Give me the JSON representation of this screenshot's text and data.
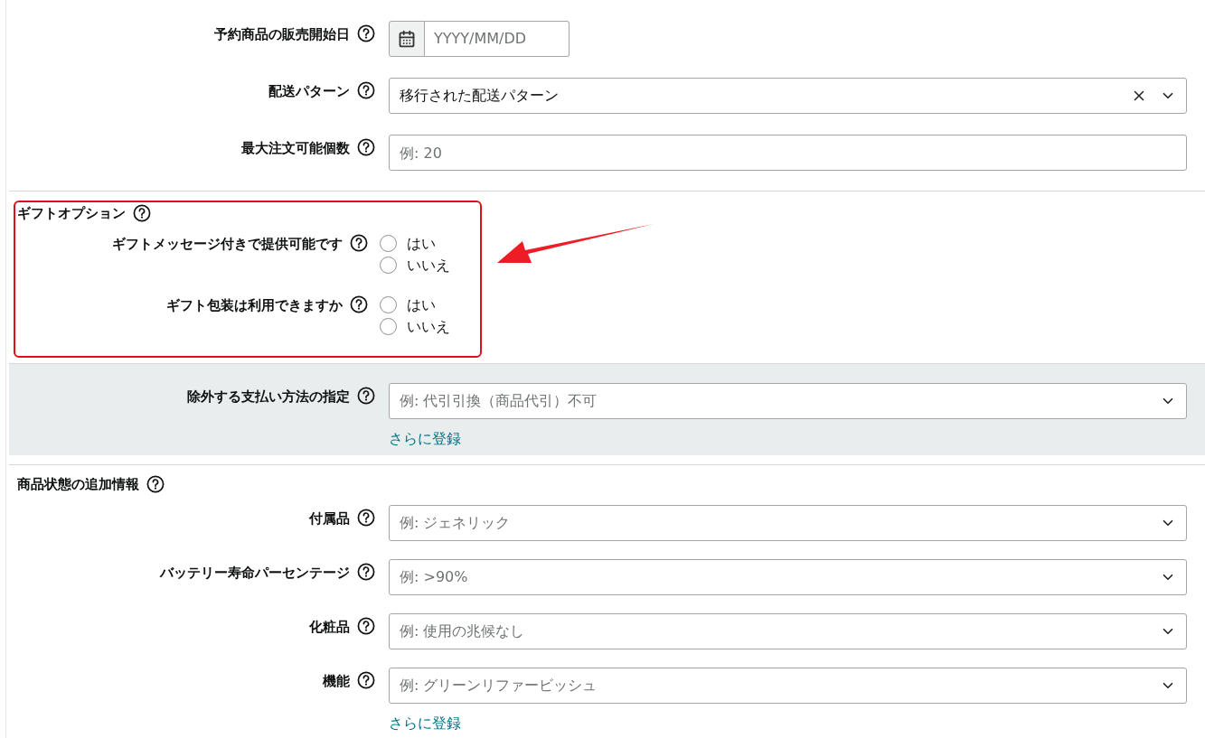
{
  "top_fields": [
    {
      "kind": "date",
      "label": "予約商品の販売開始日",
      "placeholder": "YYYY/MM/DD"
    },
    {
      "kind": "select",
      "label": "配送パターン",
      "value": "移行された配送パターン",
      "clearable": true
    },
    {
      "kind": "text",
      "label": "最大注文可能個数",
      "placeholder": "例: 20"
    }
  ],
  "gift_options": {
    "title": "ギフトオプション",
    "questions": [
      {
        "label": "ギフトメッセージ付きで提供可能です",
        "options": [
          {
            "label": "はい",
            "selected": false
          },
          {
            "label": "いいえ",
            "selected": false
          }
        ]
      },
      {
        "label": "ギフト包装は利用できますか",
        "options": [
          {
            "label": "はい",
            "selected": false
          },
          {
            "label": "いいえ",
            "selected": false
          }
        ]
      }
    ]
  },
  "payment": {
    "label": "除外する支払い方法の指定",
    "placeholder": "例: 代引引換（商品代引）不可",
    "add_link": "さらに登録"
  },
  "condition": {
    "title": "商品状態の追加情報",
    "fields": [
      {
        "label": "付属品",
        "placeholder": "例: ジェネリック"
      },
      {
        "label": "バッテリー寿命パーセンテージ",
        "placeholder": "例: >90%"
      },
      {
        "label": "化粧品",
        "placeholder": "例: 使用の兆候なし"
      },
      {
        "label": "機能",
        "placeholder": "例: グリーンリファービッシュ"
      }
    ],
    "add_link": "さらに登録"
  }
}
